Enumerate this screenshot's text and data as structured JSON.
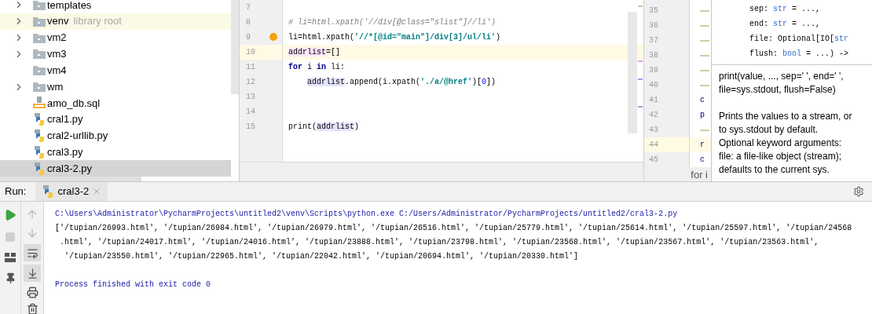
{
  "project_tree": {
    "items": [
      {
        "name": "templates",
        "kind": "folder",
        "expandable": true,
        "highlighted": false,
        "selected": false
      },
      {
        "name": "venv",
        "hint": "library root",
        "kind": "folder",
        "expandable": true,
        "highlighted": true,
        "selected": false
      },
      {
        "name": "vm2",
        "kind": "folder",
        "expandable": true,
        "highlighted": false,
        "selected": false
      },
      {
        "name": "vm3",
        "kind": "folder",
        "expandable": true,
        "highlighted": false,
        "selected": false
      },
      {
        "name": "vm4",
        "kind": "folder",
        "expandable": false,
        "highlighted": false,
        "selected": false
      },
      {
        "name": "wm",
        "kind": "folder",
        "expandable": true,
        "highlighted": false,
        "selected": false
      },
      {
        "name": "amo_db.sql",
        "kind": "sql",
        "expandable": false,
        "highlighted": false,
        "selected": false
      },
      {
        "name": "cral1.py",
        "kind": "python",
        "expandable": false,
        "highlighted": false,
        "selected": false
      },
      {
        "name": "cral2-urllib.py",
        "kind": "python",
        "expandable": false,
        "highlighted": false,
        "selected": false
      },
      {
        "name": "cral3.py",
        "kind": "python",
        "expandable": false,
        "highlighted": false,
        "selected": false
      },
      {
        "name": "cral3-2.py",
        "kind": "python",
        "expandable": false,
        "highlighted": false,
        "selected": true
      }
    ]
  },
  "editor": {
    "lines": [
      {
        "number": "7",
        "current": false
      },
      {
        "number": "8",
        "current": false,
        "tokens": [
          {
            "text": "# li=html.xpath('//div[@class=\"slist\"]//li')",
            "kind": "comment"
          }
        ]
      },
      {
        "number": "9",
        "current": false,
        "bulb": true,
        "tokens": [
          {
            "text": "li=html.xpath(",
            "kind": "plain"
          },
          {
            "text": "'//*[@id=\"main\"]/div[3]/ul/li'",
            "kind": "string"
          },
          {
            "text": ")",
            "kind": "plain"
          }
        ]
      },
      {
        "number": "10",
        "current": true,
        "tokens": [
          {
            "text": "addrlist",
            "kind": "write_ref"
          },
          {
            "text": "=[]",
            "kind": "plain"
          }
        ]
      },
      {
        "number": "11",
        "current": false,
        "tokens": [
          {
            "text": "for",
            "kind": "keyword"
          },
          {
            "text": " i ",
            "kind": "plain"
          },
          {
            "text": "in",
            "kind": "keyword"
          },
          {
            "text": " li:",
            "kind": "plain"
          }
        ]
      },
      {
        "number": "12",
        "current": false,
        "tokens": [
          {
            "text": "addrlist",
            "kind": "read_ref",
            "indent": true
          },
          {
            "text": ".append(i.xpath(",
            "kind": "plain"
          },
          {
            "text": "'./a/@href'",
            "kind": "string"
          },
          {
            "text": ")[",
            "kind": "plain"
          },
          {
            "text": "0",
            "kind": "number"
          },
          {
            "text": "])",
            "kind": "plain"
          }
        ]
      },
      {
        "number": "13",
        "current": false
      },
      {
        "number": "14",
        "current": false
      },
      {
        "number": "15",
        "current": false,
        "tokens": [
          {
            "text": "print(",
            "kind": "plain"
          },
          {
            "text": "addrlist",
            "kind": "read_ref"
          },
          {
            "text": ")",
            "kind": "plain"
          }
        ]
      }
    ]
  },
  "right_editor": {
    "lines": [
      {
        "number": "35",
        "current": false
      },
      {
        "number": "36",
        "current": false
      },
      {
        "number": "37",
        "current": false
      },
      {
        "number": "38",
        "current": false
      },
      {
        "number": "39",
        "current": false
      },
      {
        "number": "40",
        "current": false
      },
      {
        "number": "41",
        "text": "c",
        "current": false
      },
      {
        "number": "42",
        "text": "p",
        "current": false
      },
      {
        "number": "43",
        "current": false
      },
      {
        "number": "44",
        "text": "r",
        "current": true
      },
      {
        "number": "45",
        "text": "c",
        "current": false
      }
    ],
    "breadcrumb": "for i"
  },
  "doc_popup": {
    "signature_lines": [
      [
        {
          "text": "        sep: ",
          "kind": "plain"
        },
        {
          "text": "str",
          "kind": "type"
        },
        {
          "text": " = ...,",
          "kind": "plain"
        }
      ],
      [
        {
          "text": "        end: ",
          "kind": "plain"
        },
        {
          "text": "str",
          "kind": "type"
        },
        {
          "text": " = ...,",
          "kind": "plain"
        }
      ],
      [
        {
          "text": "        file: Optional[IO[",
          "kind": "plain"
        },
        {
          "text": "str",
          "kind": "type"
        }
      ],
      [
        {
          "text": "        flush: ",
          "kind": "plain"
        },
        {
          "text": "bool",
          "kind": "type"
        },
        {
          "text": " = ...) ->",
          "kind": "plain"
        }
      ]
    ],
    "paragraphs": [
      [
        "print(value, ..., sep=' ', end=' ',",
        "file=sys.stdout, flush=False)"
      ],
      [
        "Prints the values to a stream, or",
        "to sys.stdout by default.",
        "Optional keyword arguments:",
        "file: a file-like object (stream);",
        "defaults to the current sys."
      ]
    ]
  },
  "run_panel": {
    "label": "Run:",
    "tabs": [
      {
        "title": "cral3-2",
        "selected": true
      }
    ],
    "output": [
      {
        "kind": "command",
        "text": "C:\\Users\\Administrator\\PycharmProjects\\untitled2\\venv\\Scripts\\python.exe C:/Users/Administrator/PycharmProjects/untitled2/cral3-2.py"
      },
      {
        "kind": "stdout",
        "text": "['/tupian/26993.html', '/tupian/26984.html', '/tupian/26979.html', '/tupian/26516.html', '/tupian/25779.html', '/tupian/25614.html', '/tupian/25597.html', '/tupian/24568"
      },
      {
        "kind": "stdout",
        "text": " .html', '/tupian/24017.html', '/tupian/24016.html', '/tupian/23888.html', '/tupian/23798.html', '/tupian/23568.html', '/tupian/23567.html', '/tupian/23563.html',"
      },
      {
        "kind": "stdout",
        "text": "  '/tupian/23550.html', '/tupian/22965.html', '/tupian/22042.html', '/tupian/20694.html', '/tupian/20330.html']"
      },
      {
        "kind": "blank"
      },
      {
        "kind": "info",
        "text": "Process finished with exit code 0"
      }
    ]
  }
}
